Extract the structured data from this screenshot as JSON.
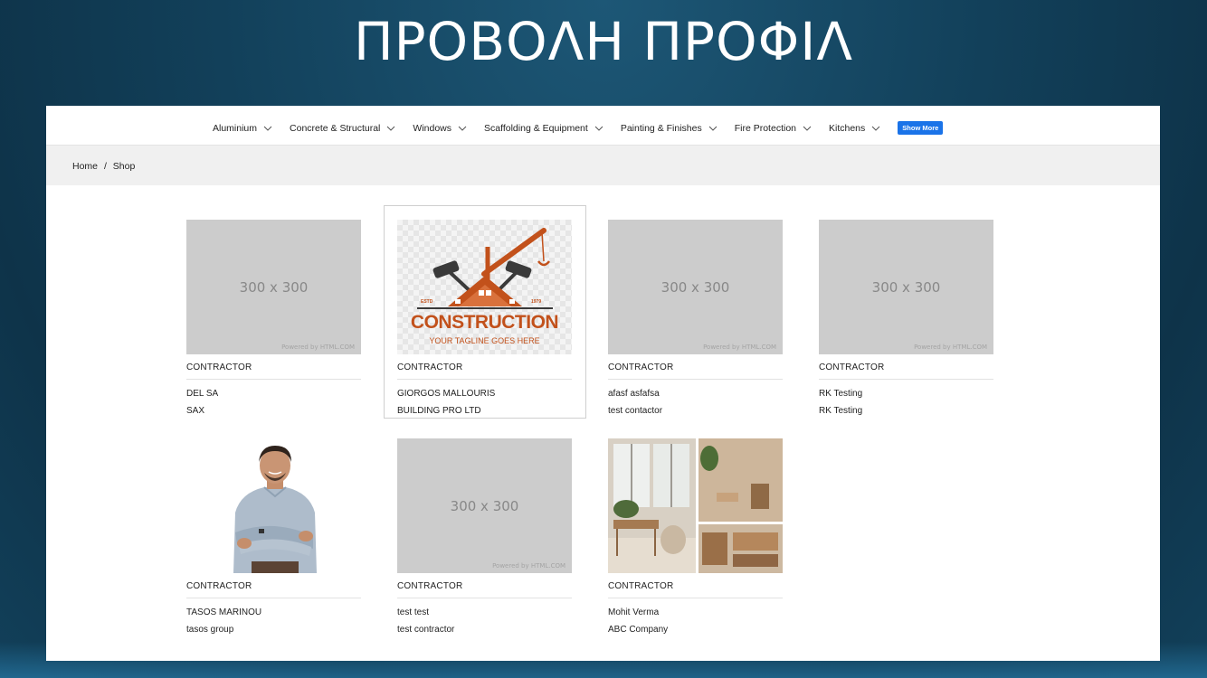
{
  "slide": {
    "title": "ΠΡΟΒΟΛΗ ΠΡΟΦΙΛ"
  },
  "nav": {
    "items": [
      {
        "label": "Aluminium"
      },
      {
        "label": "Concrete & Structural"
      },
      {
        "label": "Windows"
      },
      {
        "label": "Scaffolding & Equipment"
      },
      {
        "label": "Painting & Finishes"
      },
      {
        "label": "Fire Protection"
      },
      {
        "label": "Kitchens"
      }
    ],
    "show_more": "Show More"
  },
  "breadcrumb": {
    "home": "Home",
    "separator": "/",
    "current": "Shop"
  },
  "placeholder": {
    "size_text": "300 x 300",
    "powered_text": "Powered by HTML.COM"
  },
  "construction_logo": {
    "estd": "ESTD",
    "year": "1979",
    "word": "CONSTRUCTION",
    "tagline": "YOUR TAGLINE GOES HERE"
  },
  "cards": [
    {
      "category": "CONTRACTOR",
      "name": "DEL SA",
      "company": "SAX"
    },
    {
      "category": "CONTRACTOR",
      "name": "GIORGOS MALLOURIS",
      "company": "BUILDING PRO LTD"
    },
    {
      "category": "CONTRACTOR",
      "name": "afasf asfafsa",
      "company": "test contactor"
    },
    {
      "category": "CONTRACTOR",
      "name": "RK Testing",
      "company": "RK Testing"
    },
    {
      "category": "CONTRACTOR",
      "name": "TASOS MARINOU",
      "company": "tasos group"
    },
    {
      "category": "CONTRACTOR",
      "name": "test test",
      "company": "test contractor"
    },
    {
      "category": "CONTRACTOR",
      "name": "Mohit Verma",
      "company": "ABC Company"
    }
  ],
  "colors": {
    "accent": "#1a73e8",
    "logo_orange": "#c2511b",
    "placeholder": "#cccccc"
  }
}
